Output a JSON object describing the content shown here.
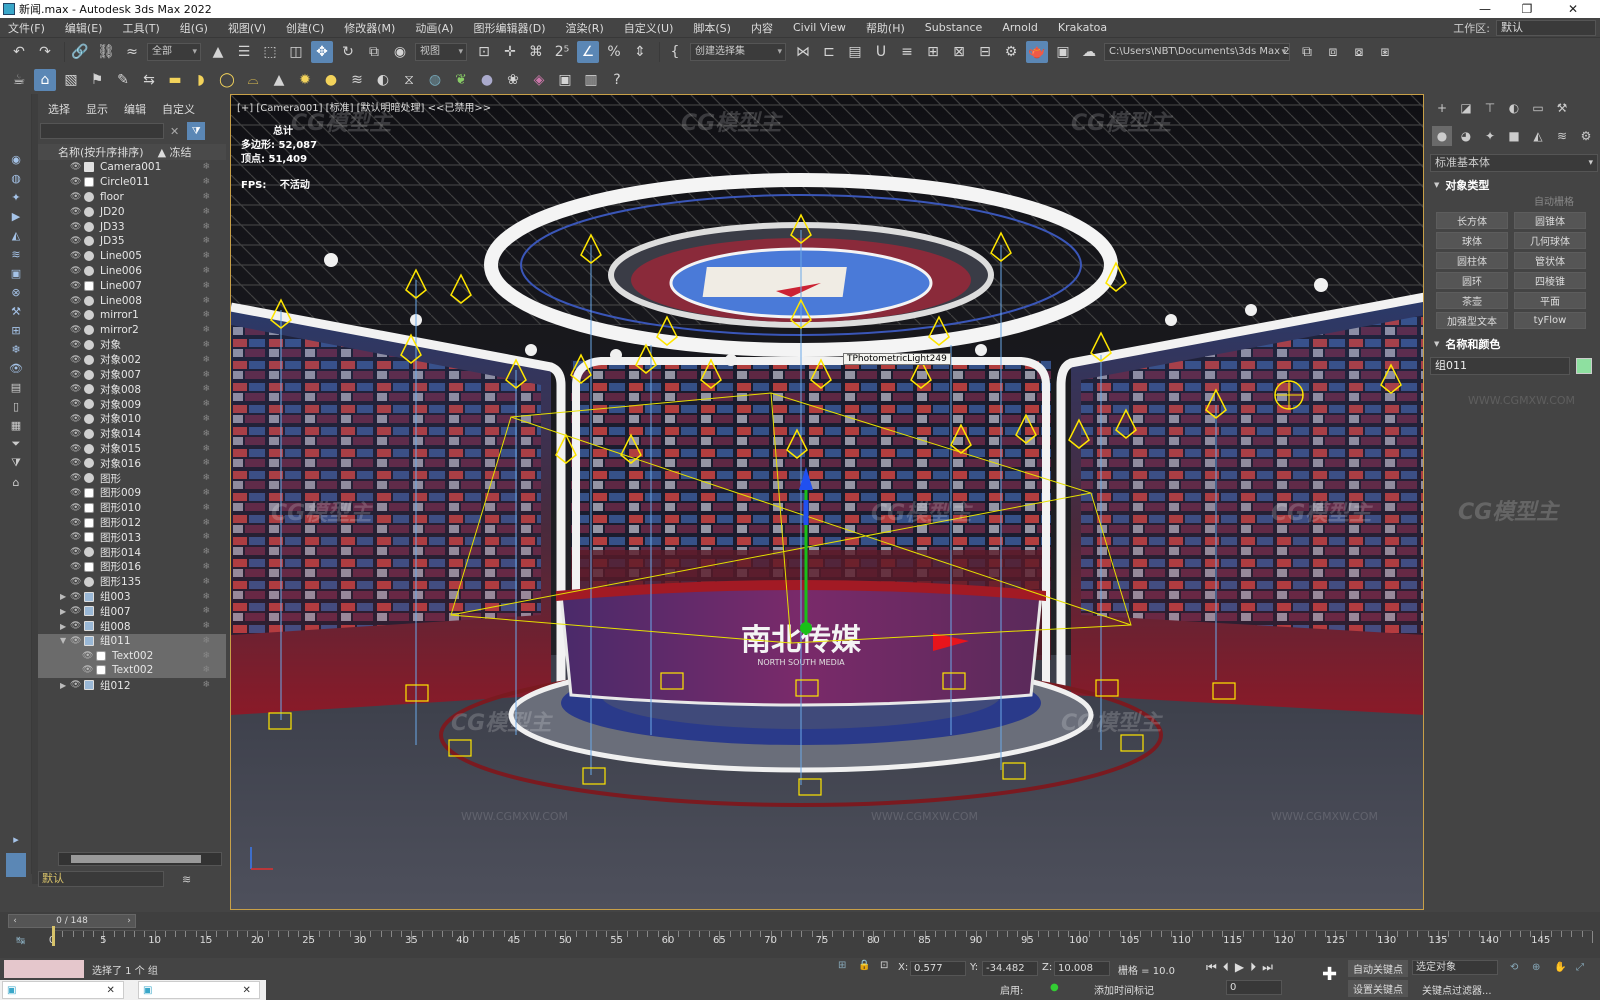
{
  "window": {
    "title": "新闻.max - Autodesk 3ds Max 2022",
    "minimize": "—",
    "restore": "❐",
    "close": "✕"
  },
  "menu": [
    "文件(F)",
    "编辑(E)",
    "工具(T)",
    "组(G)",
    "视图(V)",
    "创建(C)",
    "修改器(M)",
    "动画(A)",
    "图形编辑器(D)",
    "渲染(R)",
    "自定义(U)",
    "脚本(S)",
    "内容",
    "Civil View",
    "帮助(H)",
    "Substance",
    "Arnold",
    "Krakatoa"
  ],
  "workspace": {
    "label": "工作区:",
    "value": "默认"
  },
  "toolbar1": {
    "selection_filter": "全部",
    "ref_coord": "视图",
    "named_sel": "创建选择集",
    "project_path": "C:\\Users\\NBT\\Documents\\3ds Max 2022"
  },
  "scene_explorer": {
    "tabs": [
      "选择",
      "显示",
      "编辑",
      "自定义"
    ],
    "col_name": "名称(按升序排序)",
    "col_frozen": "▲ 冻结",
    "layer": "默认",
    "items": [
      {
        "name": "Camera001",
        "type": "cam",
        "level": 0
      },
      {
        "name": "Circle011",
        "type": "shp",
        "level": 0
      },
      {
        "name": "floor",
        "type": "obj",
        "level": 0
      },
      {
        "name": "JD20",
        "type": "obj",
        "level": 0
      },
      {
        "name": "JD33",
        "type": "obj",
        "level": 0
      },
      {
        "name": "JD35",
        "type": "obj",
        "level": 0
      },
      {
        "name": "Line005",
        "type": "obj",
        "level": 0
      },
      {
        "name": "Line006",
        "type": "obj",
        "level": 0
      },
      {
        "name": "Line007",
        "type": "shp",
        "level": 0
      },
      {
        "name": "Line008",
        "type": "obj",
        "level": 0
      },
      {
        "name": "mirror1",
        "type": "obj",
        "level": 0
      },
      {
        "name": "mirror2",
        "type": "obj",
        "level": 0
      },
      {
        "name": "对象",
        "type": "obj",
        "level": 0
      },
      {
        "name": "对象002",
        "type": "obj",
        "level": 0
      },
      {
        "name": "对象007",
        "type": "obj",
        "level": 0
      },
      {
        "name": "对象008",
        "type": "obj",
        "level": 0
      },
      {
        "name": "对象009",
        "type": "obj",
        "level": 0
      },
      {
        "name": "对象010",
        "type": "obj",
        "level": 0
      },
      {
        "name": "对象014",
        "type": "obj",
        "level": 0
      },
      {
        "name": "对象015",
        "type": "obj",
        "level": 0
      },
      {
        "name": "对象016",
        "type": "obj",
        "level": 0
      },
      {
        "name": "图形",
        "type": "obj",
        "level": 0
      },
      {
        "name": "图形009",
        "type": "shp",
        "level": 0
      },
      {
        "name": "图形010",
        "type": "shp",
        "level": 0
      },
      {
        "name": "图形012",
        "type": "shp",
        "level": 0
      },
      {
        "name": "图形013",
        "type": "shp",
        "level": 0
      },
      {
        "name": "图形014",
        "type": "obj",
        "level": 0
      },
      {
        "name": "图形016",
        "type": "shp",
        "level": 0
      },
      {
        "name": "图形135",
        "type": "obj",
        "level": 0
      },
      {
        "name": "组003",
        "type": "grp",
        "level": 0,
        "expander": "▶"
      },
      {
        "name": "组007",
        "type": "grp",
        "level": 0,
        "expander": "▶"
      },
      {
        "name": "组008",
        "type": "grp",
        "level": 0,
        "expander": "▶"
      },
      {
        "name": "组011",
        "type": "grp",
        "level": 0,
        "expander": "▼",
        "selected": true
      },
      {
        "name": "Text002",
        "type": "shp",
        "level": 1,
        "selected": true
      },
      {
        "name": "Text002",
        "type": "shp",
        "level": 1,
        "selected": true
      },
      {
        "name": "组012",
        "type": "grp",
        "level": 0,
        "expander": "▶"
      }
    ]
  },
  "viewport": {
    "label": "[+] [Camera001] [标准] [默认明暗处理] <<已禁用>>",
    "stats_title": "总计",
    "polys_label": "多边形:",
    "polys_value": "52,087",
    "verts_label": "顶点:",
    "verts_value": "51,409",
    "fps_label": "FPS:",
    "fps_value": "不活动",
    "tooltip": "TPhotometricLight249",
    "desk_logo": "南北传媒",
    "desk_sub": "NORTH SOUTH MEDIA",
    "border_color": "#c8a048"
  },
  "command_panel": {
    "dropdown": "标准基本体",
    "section_object_type": "对象类型",
    "autogrid": "自动栅格",
    "buttons": [
      "长方体",
      "圆锥体",
      "球体",
      "几何球体",
      "圆柱体",
      "管状体",
      "圆环",
      "四棱锥",
      "茶壶",
      "平面",
      "加强型文本",
      "tyFlow"
    ],
    "section_name_color": "名称和颜色",
    "object_name": "组011",
    "object_color": "#8ee0a0"
  },
  "timeline": {
    "slider_label": "0 / 148",
    "ticks": [
      "0",
      "5",
      "10",
      "15",
      "20",
      "25",
      "30",
      "35",
      "40",
      "45",
      "50",
      "55",
      "60",
      "65",
      "70",
      "75",
      "80",
      "85",
      "90",
      "95",
      "100",
      "105",
      "110",
      "115",
      "120",
      "125",
      "130",
      "135",
      "140",
      "145"
    ],
    "current_frame": 0,
    "total_frames": 148
  },
  "status": {
    "selected": "选择了 1 个 组",
    "x_label": "X:",
    "x_value": "0.577",
    "y_label": "Y:",
    "y_value": "-34.482",
    "z_label": "Z:",
    "z_value": "10.008",
    "grid": "栅格 = 10.0",
    "enable": "启用:",
    "add_time_tag": "添加时间标记",
    "auto_key": "自动关键点",
    "set_key": "设置关键点",
    "selected_objects": "选定对象",
    "key_filters": "关键点过滤器...",
    "frame_field": "0"
  },
  "watermarks": [
    "CG模型主",
    "WWW.CGMXW.COM"
  ]
}
